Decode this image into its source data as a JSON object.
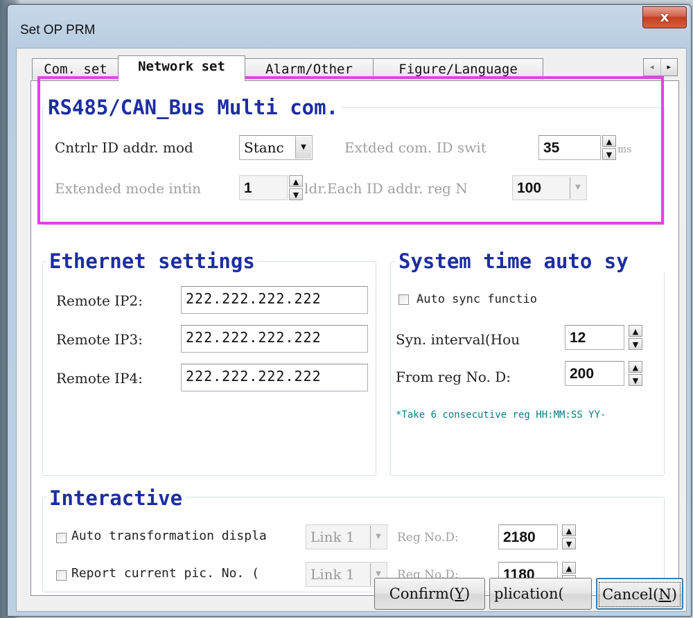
{
  "window": {
    "title": "Set OP PRM",
    "close_label": "x"
  },
  "tabs": [
    {
      "label": "Com. set",
      "active": false
    },
    {
      "label": "Network set",
      "active": true
    },
    {
      "label": "Alarm/Other",
      "active": false
    },
    {
      "label": "Figure/Language",
      "active": false
    }
  ],
  "tab_scroll": {
    "left": "◂",
    "right": "▸"
  },
  "rs485": {
    "title": "RS485/CAN_Bus Multi com.",
    "ctrl_id_label": "Cntrlr ID addr. mod",
    "ctrl_id_value": "Stanc",
    "ext_switch_label": "Extded com. ID swit",
    "ext_switch_value": "35",
    "ext_switch_suffix": "ms",
    "ext_mode_label": "Extended mode intin",
    "ext_mode_value": "1",
    "each_id_label": "ldr.Each ID addr. reg N",
    "each_id_value": "100"
  },
  "ethernet": {
    "title": "Ethernet settings",
    "rows": [
      {
        "label": "Remote IP2:",
        "value": "222.222.222.222"
      },
      {
        "label": "Remote IP3:",
        "value": "222.222.222.222"
      },
      {
        "label": "Remote IP4:",
        "value": "222.222.222.222"
      }
    ]
  },
  "systime": {
    "title": "System time auto sy",
    "auto_sync_label": "Auto sync functio",
    "interval_label": "Syn. interval(Hou",
    "interval_value": "12",
    "from_reg_label": "From reg No. D:",
    "from_reg_value": "200",
    "note": "*Take 6 consecutive reg HH:MM:SS YY-"
  },
  "interactive": {
    "title": "Interactive",
    "rows": [
      {
        "label": "Auto transformation displa",
        "link": "Link 1",
        "reg_label": "Reg No.D:",
        "reg_value": "2180"
      },
      {
        "label": "Report current pic. No.   (",
        "link": "Link 1",
        "reg_label": "Reg No.D:",
        "reg_value": "1180"
      }
    ]
  },
  "buttons": {
    "confirm": "Confirm(",
    "confirm_key": "Y",
    "confirm_end": ")",
    "apply": "plication(",
    "cancel": "Cancel(",
    "cancel_key": "N",
    "cancel_end": ")"
  }
}
